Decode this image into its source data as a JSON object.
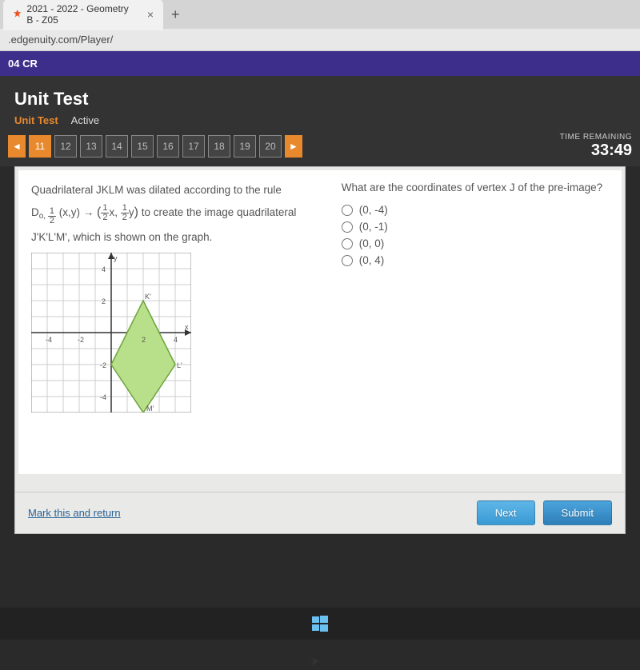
{
  "browser": {
    "tab_title": "2021 - 2022 - Geometry B - Z05",
    "url": ".edgenuity.com/Player/"
  },
  "course_bar": "04 CR",
  "page": {
    "title": "Unit Test",
    "subtitle": "Unit Test",
    "status": "Active"
  },
  "nav": {
    "items": [
      "11",
      "12",
      "13",
      "14",
      "15",
      "16",
      "17",
      "18",
      "19",
      "20"
    ],
    "current": "11"
  },
  "timer": {
    "label": "TIME REMAINING",
    "value": "33:49"
  },
  "question": {
    "left_line1": "Quadrilateral JKLM was dilated according to the rule",
    "rule_prefix": "D",
    "rule_sub_center": "o",
    "left_line2_mid": "(x,y) →",
    "left_line2_suffix": "to create the image quadrilateral",
    "left_line3": "J'K'L'M', which is shown on the graph.",
    "prompt": "What are the coordinates of vertex J of the pre-image?",
    "options": [
      "(0, -4)",
      "(0, -1)",
      "(0, 0)",
      "(0, 4)"
    ]
  },
  "footer": {
    "mark": "Mark this and return",
    "next": "Next",
    "submit": "Submit"
  },
  "chart_data": {
    "type": "scatter",
    "title": "",
    "xlabel": "x",
    "ylabel": "y",
    "xlim": [
      -5,
      5
    ],
    "ylim": [
      -5,
      5
    ],
    "grid": true,
    "series": [
      {
        "name": "J'K'L'M' (quadrilateral image)",
        "points": [
          {
            "label": "J'",
            "x": 0,
            "y": -2
          },
          {
            "label": "K'",
            "x": 2,
            "y": 2
          },
          {
            "label": "L'",
            "x": 4,
            "y": -2
          },
          {
            "label": "M'",
            "x": 2,
            "y": -5
          }
        ],
        "closed": true,
        "fill": "#b8e08a"
      }
    ],
    "ticks_x": [
      -4,
      -2,
      2,
      4
    ],
    "ticks_y": [
      -4,
      -2,
      2,
      4
    ]
  }
}
